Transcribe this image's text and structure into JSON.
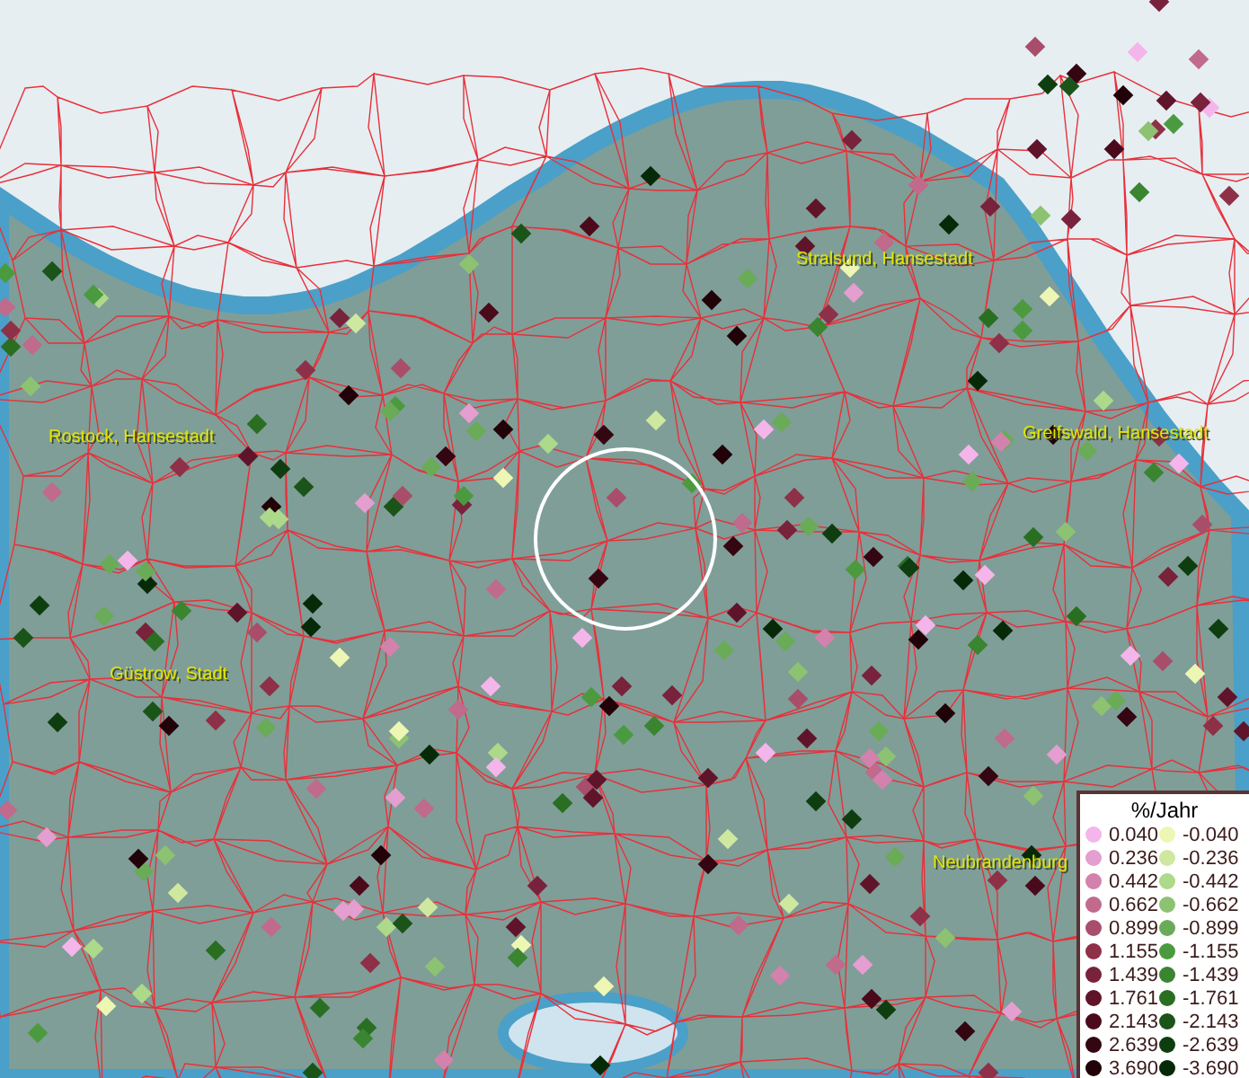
{
  "map": {
    "places": [
      {
        "name": "Stralsund, Hansestadt"
      },
      {
        "name": "Rostock, Hansestadt"
      },
      {
        "name": "Greifswald, Hansestadt"
      },
      {
        "name": "Güstrow, Stadt"
      },
      {
        "name": "Neubrandenburg"
      }
    ]
  },
  "legend": {
    "title": "%/Jahr",
    "entries": [
      {
        "value": "0.040",
        "color": "#f4b6ea"
      },
      {
        "value": "-0.040",
        "color": "#eef6b4"
      },
      {
        "value": "0.236",
        "color": "#e49ed0"
      },
      {
        "value": "-0.236",
        "color": "#cfe8a0"
      },
      {
        "value": "0.442",
        "color": "#d282ac"
      },
      {
        "value": "-0.442",
        "color": "#acd98a"
      },
      {
        "value": "0.662",
        "color": "#c06a8c"
      },
      {
        "value": "-0.662",
        "color": "#8cc272"
      },
      {
        "value": "0.899",
        "color": "#a84e6a"
      },
      {
        "value": "-0.899",
        "color": "#6aab58"
      },
      {
        "value": "1.155",
        "color": "#8e3048"
      },
      {
        "value": "-1.155",
        "color": "#4c9a40"
      },
      {
        "value": "1.439",
        "color": "#78223c"
      },
      {
        "value": "-1.439",
        "color": "#3a8530"
      },
      {
        "value": "1.761",
        "color": "#60142a"
      },
      {
        "value": "-1.761",
        "color": "#2a6e22"
      },
      {
        "value": "2.143",
        "color": "#4a0a1c"
      },
      {
        "value": "-2.143",
        "color": "#1a5418"
      },
      {
        "value": "2.639",
        "color": "#340612"
      },
      {
        "value": "-2.639",
        "color": "#0e3e10"
      },
      {
        "value": "3.690",
        "color": "#200208"
      },
      {
        "value": "-3.690",
        "color": "#062a08"
      }
    ]
  }
}
